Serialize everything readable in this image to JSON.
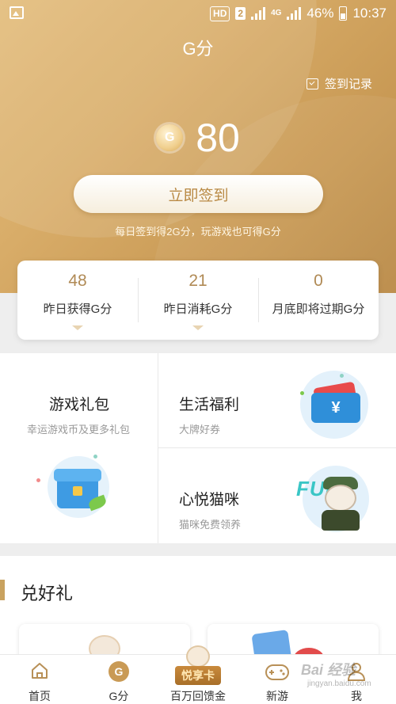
{
  "status_bar": {
    "hd": "HD",
    "sim": "2",
    "network": "4G",
    "battery": "46%",
    "time": "10:37"
  },
  "header": {
    "title": "G分",
    "record_label": "签到记录"
  },
  "balance": {
    "coin_symbol": "G",
    "points": "80"
  },
  "checkin": {
    "button_label": "立即签到",
    "hint": "每日签到得2G分，玩游戏也可得G分"
  },
  "stats": [
    {
      "value": "48",
      "label": "昨日获得G分"
    },
    {
      "value": "21",
      "label": "昨日消耗G分"
    },
    {
      "value": "0",
      "label": "月底即将过期G分"
    }
  ],
  "benefits": {
    "game_gift": {
      "title": "游戏礼包",
      "subtitle": "幸运游戏币及更多礼包"
    },
    "life_welfare": {
      "title": "生活福利",
      "subtitle": "大牌好券",
      "ticket_symbol": "¥"
    },
    "cat": {
      "title": "心悦猫咪",
      "subtitle": "猫咪免费领养",
      "fun_text": "FUN"
    }
  },
  "exchange_section": {
    "title": "兑好礼"
  },
  "bottom_nav": {
    "home": "首页",
    "g_points": "G分",
    "g_icon": "G",
    "vip_badge": "悦享卡",
    "vip": "百万回馈金",
    "new_games": "新游",
    "me": "我"
  },
  "watermark": {
    "brand": "Bai 经验",
    "url": "jingyan.baidu.com"
  },
  "colors": {
    "accent_gold": "#c99a55",
    "stat_number": "#b08a55",
    "ticket_blue": "#2f8fd9"
  },
  "icons": [
    "image-icon",
    "signal-icon",
    "battery-icon",
    "calendar-check-icon",
    "coin-icon",
    "home-icon",
    "g-points-icon",
    "gamepad-icon",
    "user-icon"
  ]
}
